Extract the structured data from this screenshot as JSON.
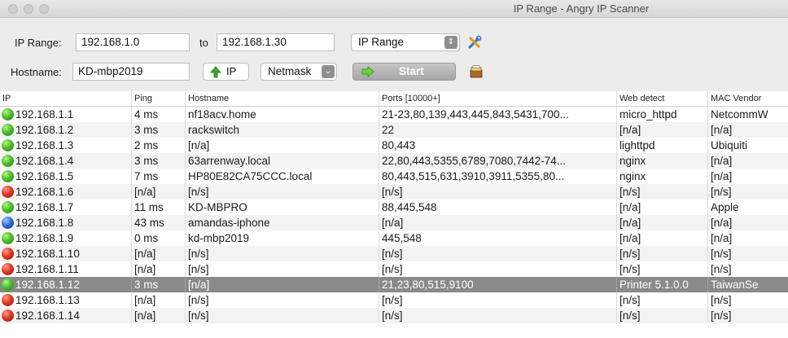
{
  "window": {
    "title": "IP Range - Angry IP Scanner"
  },
  "toolbar": {
    "ip_range_label": "IP Range:",
    "ip_from": "192.168.1.0",
    "to_label": "to",
    "ip_to": "192.168.1.30",
    "feeder_select": "IP Range",
    "hostname_label": "Hostname:",
    "hostname_value": "KD-mbp2019",
    "ip_button_label": "IP",
    "netmask_select": "Netmask",
    "start_label": "Start"
  },
  "table": {
    "columns": [
      "IP",
      "Ping",
      "Hostname",
      "Ports [10000+]",
      "Web detect",
      "MAC Vendor"
    ],
    "rows": [
      {
        "status": "green",
        "ip": "192.168.1.1",
        "ping": "4 ms",
        "hostname": "nf18acv.home",
        "ports": "21-23,80,139,443,445,843,5431,700...",
        "web": "micro_httpd",
        "mac": "NetcommW"
      },
      {
        "status": "green",
        "ip": "192.168.1.2",
        "ping": "3 ms",
        "hostname": "rackswitch",
        "ports": "22",
        "web": "[n/a]",
        "mac": "[n/a]"
      },
      {
        "status": "green",
        "ip": "192.168.1.3",
        "ping": "2 ms",
        "hostname": "[n/a]",
        "ports": "80,443",
        "web": "lighttpd",
        "mac": "Ubiquiti"
      },
      {
        "status": "green",
        "ip": "192.168.1.4",
        "ping": "3 ms",
        "hostname": "63arrenway.local",
        "ports": "22,80,443,5355,6789,7080,7442-74...",
        "web": "nginx",
        "mac": "[n/a]"
      },
      {
        "status": "green",
        "ip": "192.168.1.5",
        "ping": "7 ms",
        "hostname": "HP80E82CA75CCC.local",
        "ports": "80,443,515,631,3910,3911,5355,80...",
        "web": "nginx",
        "mac": "[n/a]"
      },
      {
        "status": "red",
        "ip": "192.168.1.6",
        "ping": "[n/a]",
        "hostname": "[n/s]",
        "ports": "[n/s]",
        "web": "[n/s]",
        "mac": "[n/s]"
      },
      {
        "status": "green",
        "ip": "192.168.1.7",
        "ping": "11 ms",
        "hostname": "KD-MBPRO",
        "ports": "88,445,548",
        "web": "[n/a]",
        "mac": "Apple"
      },
      {
        "status": "blue",
        "ip": "192.168.1.8",
        "ping": "43 ms",
        "hostname": "amandas-iphone",
        "ports": "[n/a]",
        "web": "[n/a]",
        "mac": "[n/a]"
      },
      {
        "status": "green",
        "ip": "192.168.1.9",
        "ping": "0 ms",
        "hostname": "kd-mbp2019",
        "ports": "445,548",
        "web": "[n/a]",
        "mac": "[n/a]"
      },
      {
        "status": "red",
        "ip": "192.168.1.10",
        "ping": "[n/a]",
        "hostname": "[n/s]",
        "ports": "[n/s]",
        "web": "[n/s]",
        "mac": "[n/s]"
      },
      {
        "status": "red",
        "ip": "192.168.1.11",
        "ping": "[n/a]",
        "hostname": "[n/s]",
        "ports": "[n/s]",
        "web": "[n/s]",
        "mac": "[n/s]"
      },
      {
        "status": "green",
        "ip": "192.168.1.12",
        "ping": "3 ms",
        "hostname": "[n/a]",
        "ports": "21,23,80,515,9100",
        "web": "Printer 5.1.0.0",
        "mac": "TaiwanSe",
        "selected": true
      },
      {
        "status": "red",
        "ip": "192.168.1.13",
        "ping": "[n/a]",
        "hostname": "[n/s]",
        "ports": "[n/s]",
        "web": "[n/s]",
        "mac": "[n/s]"
      },
      {
        "status": "red",
        "ip": "192.168.1.14",
        "ping": "[n/a]",
        "hostname": "[n/s]",
        "ports": "[n/s]",
        "web": "[n/s]",
        "mac": "[n/s]"
      }
    ]
  }
}
